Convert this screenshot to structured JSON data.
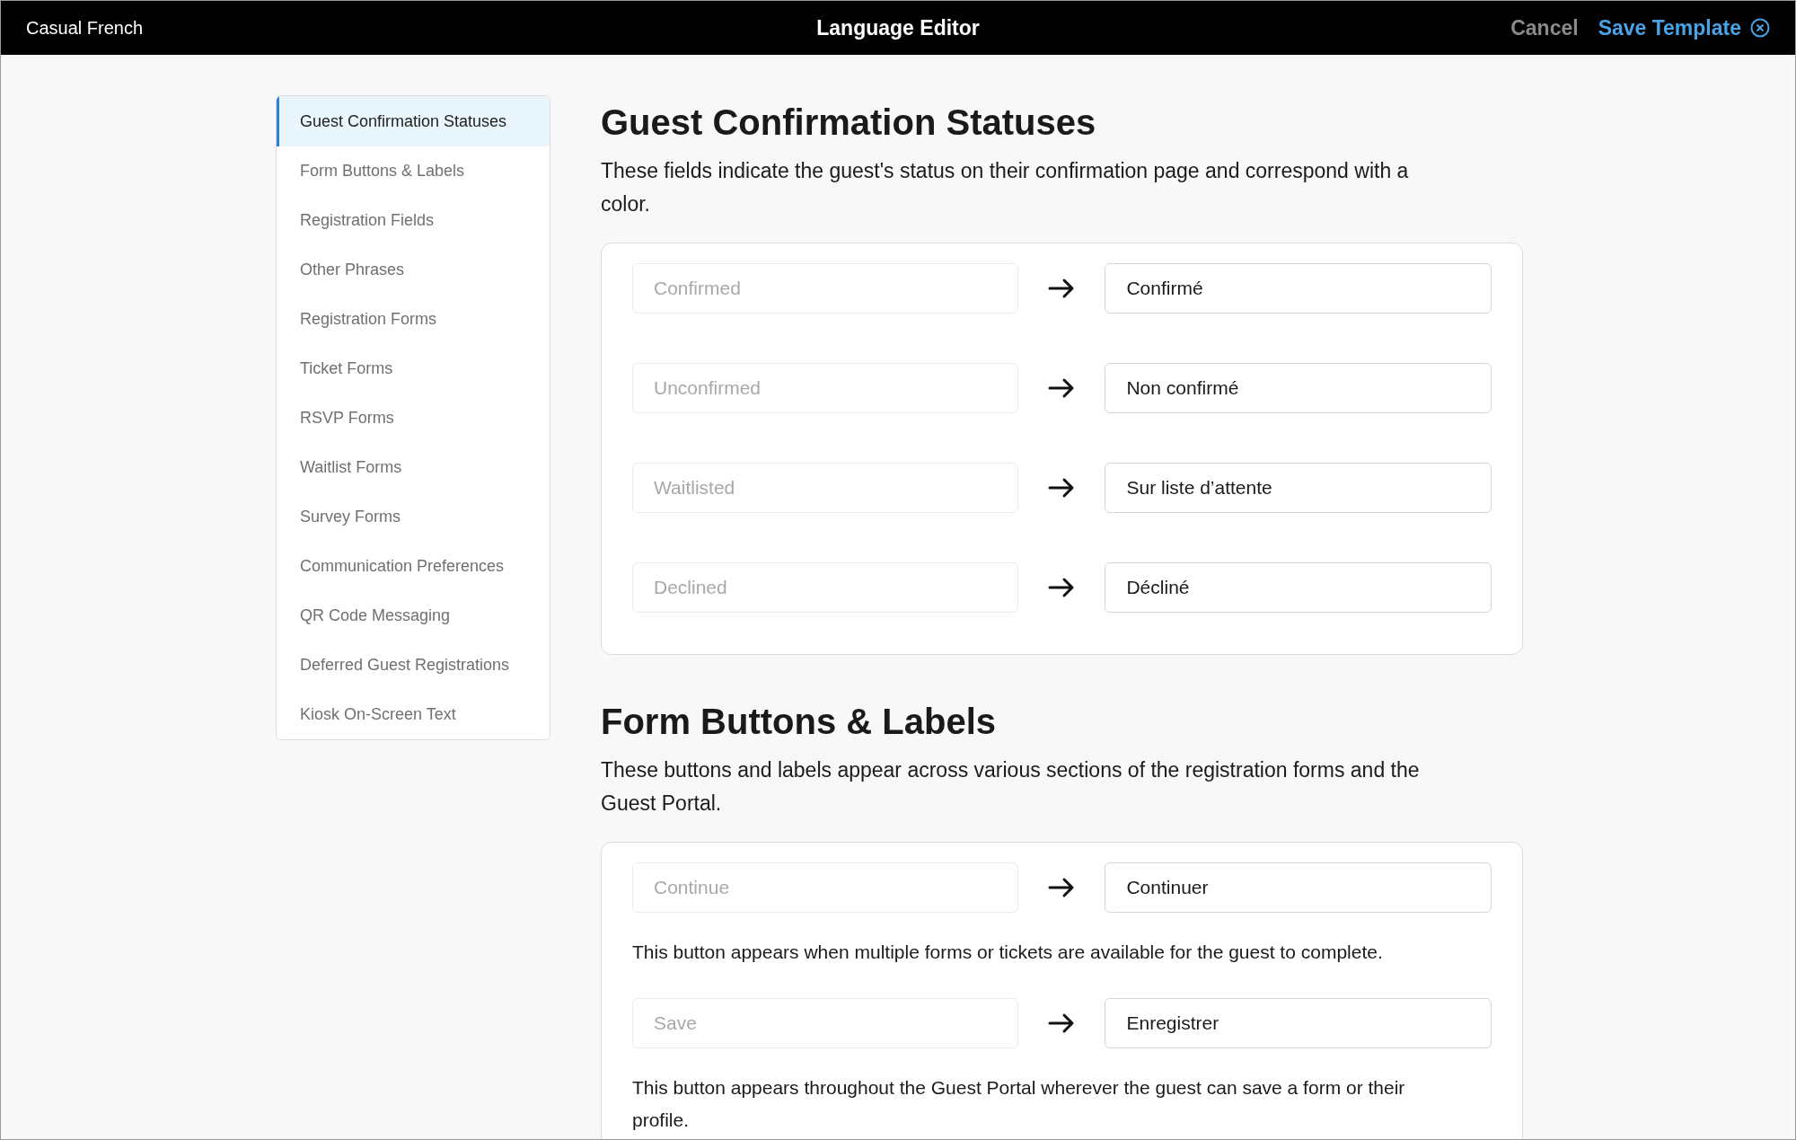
{
  "header": {
    "template_name": "Casual French",
    "title": "Language Editor",
    "cancel": "Cancel",
    "save": "Save Template"
  },
  "sidebar": {
    "items": [
      {
        "label": "Guest Confirmation Statuses",
        "selected": true
      },
      {
        "label": "Form Buttons & Labels",
        "selected": false
      },
      {
        "label": "Registration Fields",
        "selected": false
      },
      {
        "label": "Other Phrases",
        "selected": false
      },
      {
        "label": "Registration Forms",
        "selected": false
      },
      {
        "label": "Ticket Forms",
        "selected": false
      },
      {
        "label": "RSVP Forms",
        "selected": false
      },
      {
        "label": "Waitlist Forms",
        "selected": false
      },
      {
        "label": "Survey Forms",
        "selected": false
      },
      {
        "label": "Communication Preferences",
        "selected": false
      },
      {
        "label": "QR Code Messaging",
        "selected": false
      },
      {
        "label": "Deferred Guest Registrations",
        "selected": false
      },
      {
        "label": "Kiosk On-Screen Text",
        "selected": false
      }
    ]
  },
  "sections": [
    {
      "title": "Guest Confirmation Statuses",
      "description": "These fields indicate the guest's status on their confirmation page and correspond with a color.",
      "rows": [
        {
          "source": "Confirmed",
          "translation": "Confirmé"
        },
        {
          "source": "Unconfirmed",
          "translation": "Non confirmé"
        },
        {
          "source": "Waitlisted",
          "translation": "Sur liste d’attente"
        },
        {
          "source": "Declined",
          "translation": "Décliné"
        }
      ]
    },
    {
      "title": "Form Buttons & Labels",
      "description": "These buttons and labels appear across various sections of the registration forms and the Guest Portal.",
      "rows": [
        {
          "source": "Continue",
          "translation": "Continuer",
          "note": "This button appears when multiple forms or tickets are available for the guest to complete."
        },
        {
          "source": "Save",
          "translation": "Enregistrer",
          "note": "This button appears throughout the Guest Portal wherever the guest can save a form or their profile."
        }
      ]
    }
  ]
}
